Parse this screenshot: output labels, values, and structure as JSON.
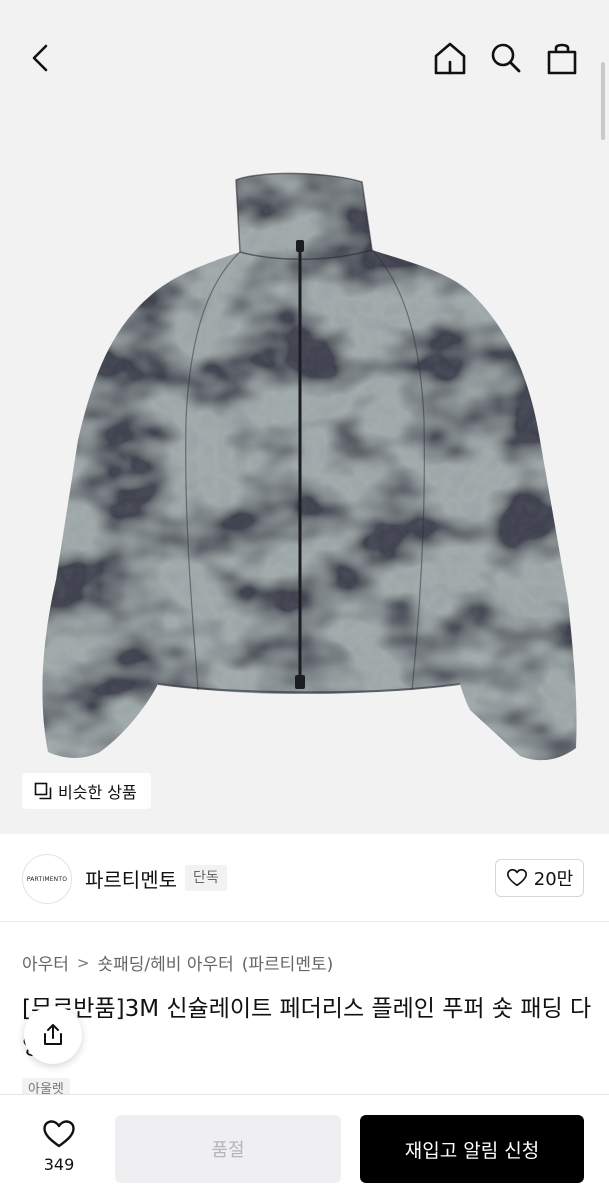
{
  "similar_chip": {
    "label": "비슷한 상품"
  },
  "brand": {
    "logo_text": "PARTIMENTO",
    "name": "파르티멘토",
    "tag": "단독",
    "likes": "20만"
  },
  "breadcrumb": {
    "items": [
      "아우터",
      "숏패딩/헤비 아우터",
      "(파르티멘토)"
    ],
    "separator": ">"
  },
  "product": {
    "title": "[무료반품]3M 신슐레이트 페더리스 플레인 푸퍼 숏 패딩 다잉",
    "badge": "아울렛"
  },
  "bottom_bar": {
    "wish_count": "349",
    "soldout_label": "품절",
    "restock_label": "재입고 알림 신청"
  },
  "icons": {
    "back": "back-arrow-icon",
    "home": "home-icon",
    "search": "search-icon",
    "bag": "shopping-bag-icon",
    "similar": "similar-items-icon",
    "heart": "heart-icon",
    "share": "share-icon"
  },
  "colors": {
    "hero_bg": "#f2f2f3",
    "cta_bg": "#000000",
    "soldout_bg": "#efeff1"
  }
}
